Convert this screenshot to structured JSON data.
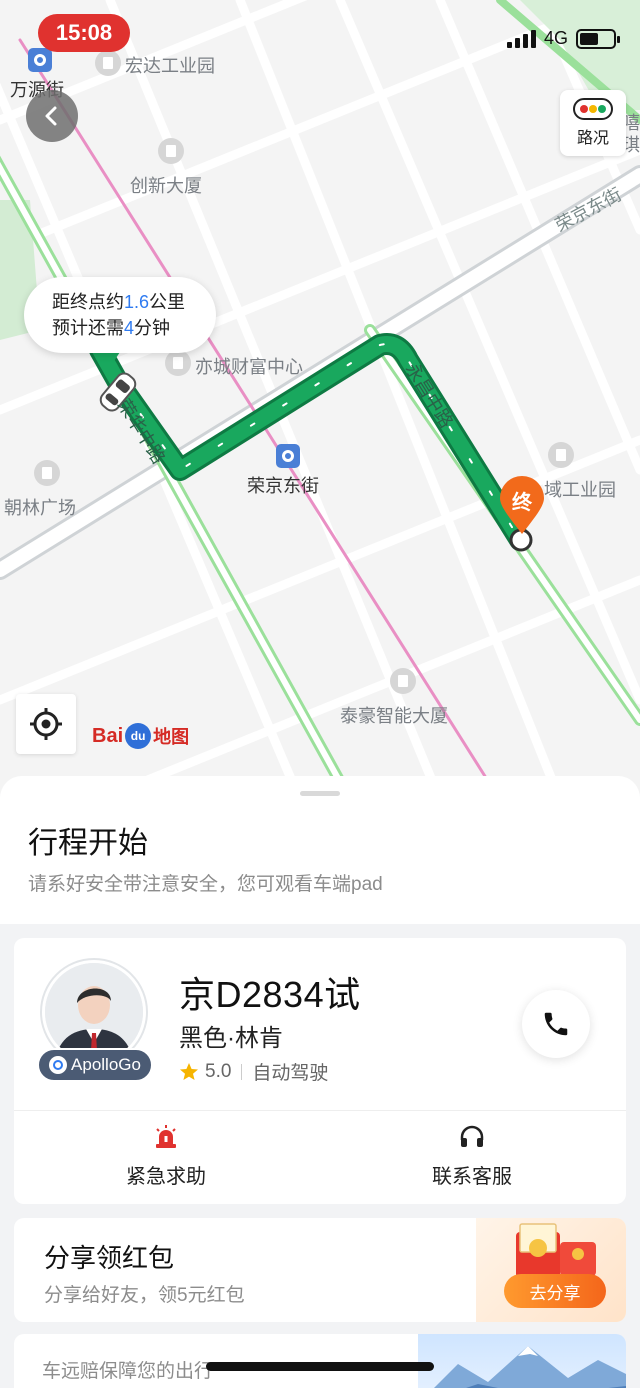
{
  "status_bar": {
    "time": "15:08",
    "network": "4G"
  },
  "map": {
    "traffic_label": "路况",
    "labels": {
      "wanyuan": "万源街",
      "hongda": "宏达工业园",
      "chuangxin": "创新大厦",
      "yicheng": "亦城财富中心",
      "rongjing_station": "荣京东街",
      "chaolin": "朝林广场",
      "industrial_park": "域工业园",
      "taihao": "泰豪智能大厦",
      "rongjing_road": "荣京东街",
      "ronghua_road": "荣华中路",
      "yongchang_road": "永昌中路",
      "edge_text": "嘻\n琪"
    },
    "bubble": {
      "line1_prefix": "距终点约",
      "distance": "1.6",
      "line1_suffix": "公里",
      "line2_prefix": "预计还需",
      "minutes": "4",
      "line2_suffix": "分钟"
    },
    "destination_marker": "终",
    "logo_bai": "Bai",
    "logo_du": "du",
    "logo_ditu": "地图"
  },
  "trip": {
    "title": "行程开始",
    "subtitle": "请系好安全带注意安全，您可观看车端pad"
  },
  "driver": {
    "plate": "京D2834试",
    "car": "黑色·林肯",
    "rating": "5.0",
    "mode": "自动驾驶",
    "badge": "ApolloGo"
  },
  "actions": {
    "emergency": "紧急求助",
    "service": "联系客服"
  },
  "share": {
    "title": "分享领红包",
    "subtitle": "分享给好友，领5元红包",
    "button": "去分享"
  },
  "insurance": {
    "text": "车远赔保障您的出行"
  },
  "colors": {
    "route": "#15a05a",
    "accent_blue": "#2f7bf1",
    "status_red": "#e0322f",
    "marker_orange": "#f26a1b",
    "share_orange": "#f4661b"
  },
  "icons": [
    "chevron-left-icon",
    "traffic-light-icon",
    "locate-icon",
    "phone-icon",
    "alarm-icon",
    "headset-icon",
    "star-icon",
    "red-envelope-icon"
  ]
}
